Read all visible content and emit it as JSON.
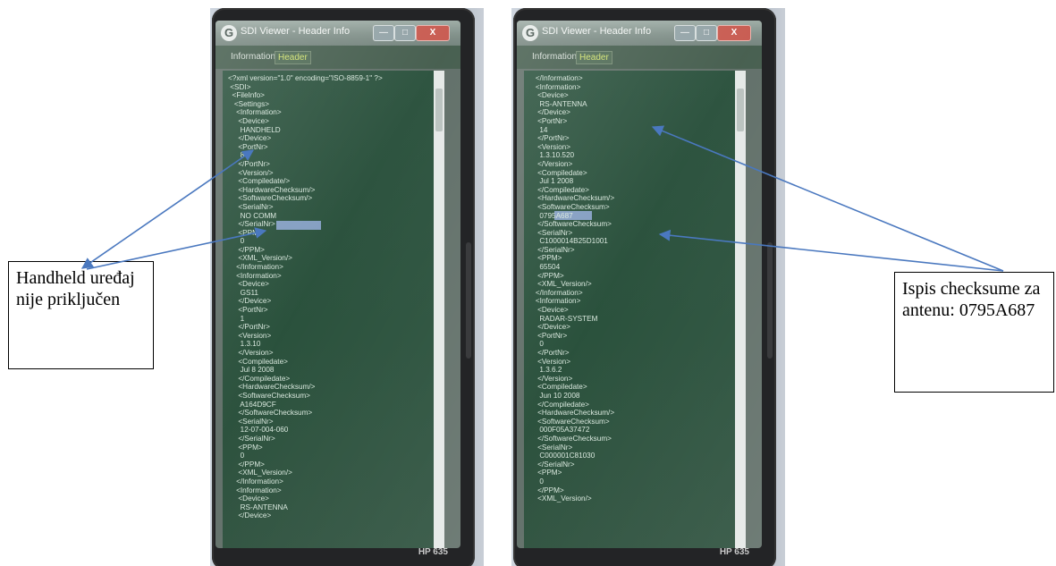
{
  "screenshots": [
    {
      "window_title": "SDI Viewer - Header Info",
      "tabs": [
        "Information",
        "Header"
      ],
      "buttons": {
        "minimize": "—",
        "maximize": "□",
        "close": "X"
      },
      "xml_text": "<?xml version=\"1.0\" encoding=\"ISO-8859-1\" ?>\n <SDI>\n  <FileInfo>\n   <Settings>\n    <Information>\n     <Device>\n      HANDHELD\n     </Device>\n     <PortNr>\n      8\n     </PortNr>\n     <Version/>\n     <Compiledate/>\n     <HardwareChecksum/>\n     <SoftwareChecksum/>\n     <SerialNr>\n      NO COMM\n     </SerialNr>\n     <PPM>\n      0\n     </PPM>\n     <XML_Version/>\n    </Information>\n    <Information>\n     <Device>\n      GS11\n     </Device>\n     <PortNr>\n      1\n     </PortNr>\n     <Version>\n      1.3.10\n     </Version>\n     <Compiledate>\n      Jul 8 2008\n     </Compiledate>\n     <HardwareChecksum/>\n     <SoftwareChecksum>\n      A164D9CF\n     </SoftwareChecksum>\n     <SerialNr>\n      12-07-004-060\n     </SerialNr>\n     <PPM>\n      0\n     </PPM>\n     <XML_Version/>\n    </Information>\n    <Information>\n     <Device>\n      RS-ANTENNA\n     </Device>",
      "brand": "HP 635"
    },
    {
      "window_title": "SDI Viewer - Header Info",
      "tabs": [
        "Information",
        "Header"
      ],
      "buttons": {
        "minimize": "—",
        "maximize": "□",
        "close": "X"
      },
      "xml_text": "   </Information>\n   <Information>\n    <Device>\n     RS-ANTENNA\n    </Device>\n    <PortNr>\n     14\n    </PortNr>\n    <Version>\n     1.3.10.520\n    </Version>\n    <Compiledate>\n     Jul 1 2008\n    </Compiledate>\n    <HardwareChecksum/>\n    <SoftwareChecksum>\n     0795A687\n    </SoftwareChecksum>\n    <SerialNr>\n     C1000014B25D1001\n    </SerialNr>\n    <PPM>\n     65504\n    </PPM>\n    <XML_Version/>\n   </Information>\n   <Information>\n    <Device>\n     RADAR-SYSTEM\n    </Device>\n    <PortNr>\n     0\n    </PortNr>\n    <Version>\n     1.3.6.2\n    </Version>\n    <Compiledate>\n     Jun 10 2008\n    </Compiledate>\n    <HardwareChecksum/>\n    <SoftwareChecksum>\n     000F05A37472\n    </SoftwareChecksum>\n    <SerialNr>\n     C000001C81030\n    </SerialNr>\n    <PPM>\n     0\n    </PPM>\n    <XML_Version/>",
      "brand": "HP 635"
    }
  ],
  "annotations": {
    "left": "Handheld uređaj nije priključen",
    "right": "Ispis checksume za antenu: 0795A687"
  },
  "colors": {
    "arrow": "#4a78bf",
    "selection": "#8ea8d8",
    "xml_background": "#1f4832"
  }
}
